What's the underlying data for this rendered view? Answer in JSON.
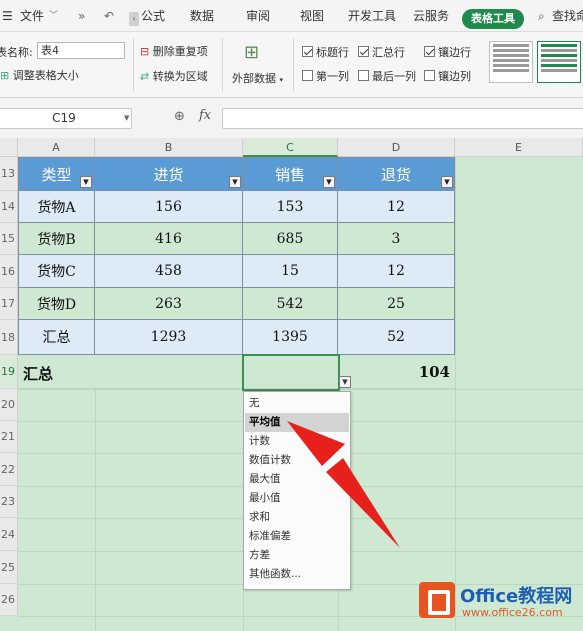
{
  "menubar": {
    "menu_label": "文件",
    "items": [
      "公式",
      "数据",
      "审阅",
      "视图",
      "开发工具",
      "云服务"
    ],
    "active_tab": "表格工具",
    "search_label": "查找命"
  },
  "ribbon": {
    "table_name_label": "表名称:",
    "table_name_value": "表4",
    "resize_table": "调整表格大小",
    "remove_duplicates": "删除重复项",
    "convert_to_range": "转换为区域",
    "external_data": "外部数据",
    "options": [
      {
        "label": "标题行",
        "checked": true
      },
      {
        "label": "汇总行",
        "checked": true
      },
      {
        "label": "镶边行",
        "checked": true
      },
      {
        "label": "第一列",
        "checked": false
      },
      {
        "label": "最后一列",
        "checked": false
      },
      {
        "label": "镶边列",
        "checked": false
      }
    ]
  },
  "formula_bar": {
    "name_box": "C19",
    "fx": "fx",
    "formula": ""
  },
  "sheet": {
    "columns": [
      "A",
      "B",
      "C",
      "D",
      "E"
    ],
    "rows": [
      "13",
      "14",
      "15",
      "16",
      "17",
      "18",
      "19",
      "20",
      "21",
      "22",
      "23",
      "24",
      "25",
      "26"
    ],
    "header": [
      "类型",
      "进货",
      "销售",
      "退货"
    ],
    "data": [
      [
        "货物A",
        "156",
        "153",
        "12"
      ],
      [
        "货物B",
        "416",
        "685",
        "3"
      ],
      [
        "货物C",
        "458",
        "15",
        "12"
      ],
      [
        "货物D",
        "263",
        "542",
        "25"
      ],
      [
        "汇总",
        "1293",
        "1395",
        "52"
      ]
    ],
    "total_row": {
      "label": "汇总",
      "c_value": "",
      "d_value": "104"
    }
  },
  "dropdown": {
    "items": [
      "无",
      "平均值",
      "计数",
      "数值计数",
      "最大值",
      "最小值",
      "求和",
      "标准偏差",
      "方差",
      "其他函数..."
    ],
    "highlighted_index": 1
  },
  "watermark": {
    "title": "Office教程网",
    "url": "www.office26.com"
  },
  "colors": {
    "accent_green": "#1f8a4c",
    "table_header": "#5b9bd5",
    "band_blue": "#ddebf7",
    "band_green": "#cfe8d1",
    "arrow_red": "#e8201c"
  }
}
